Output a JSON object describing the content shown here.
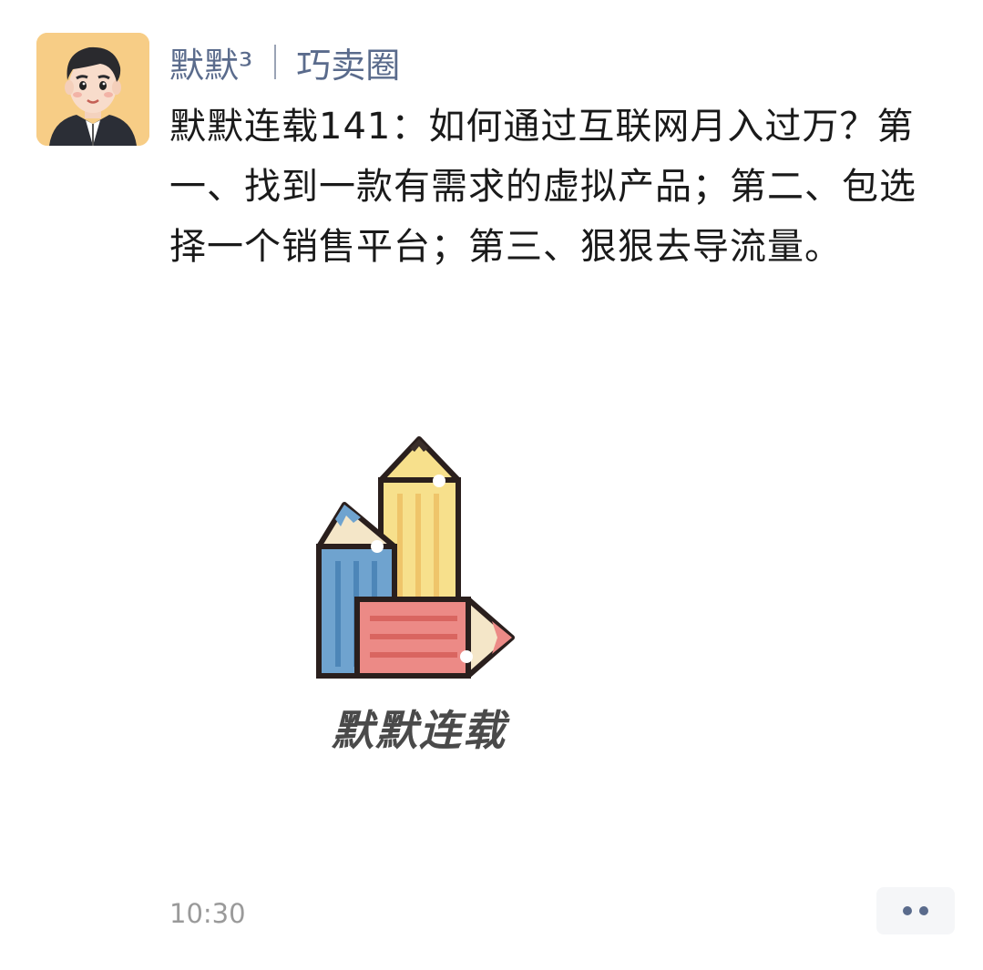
{
  "post": {
    "author_name": "默默³",
    "circle_name": "巧卖圈",
    "text": "默默连载141：如何通过互联网月入过万？第一、找到一款有需求的虚拟产品；第二、包选择一个销售平台；第三、狠狠去导流量。",
    "image_caption": "默默连载",
    "timestamp": "10:30"
  },
  "icons": {
    "avatar": "cartoon-man-avatar",
    "image": "pencils-logo",
    "more": "more-dots-icon"
  },
  "colors": {
    "link": "#5a6b8c",
    "avatar_bg": "#f7cd86",
    "pencil_yellow": "#f7e08c",
    "pencil_blue": "#6fa3cf",
    "pencil_red": "#ec8a86"
  }
}
